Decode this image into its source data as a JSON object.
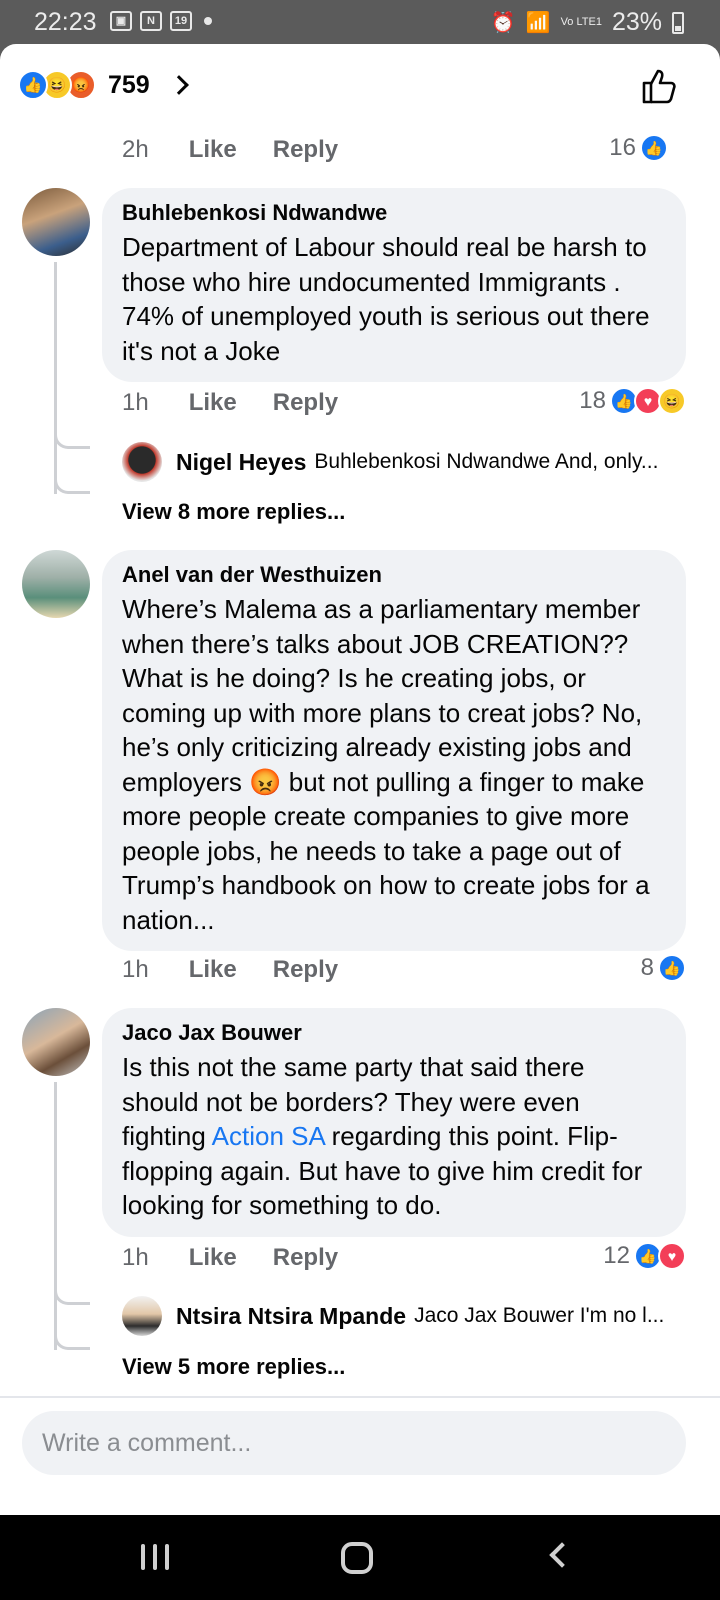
{
  "status_bar": {
    "time": "22:23",
    "notif_icons": [
      "gallery-icon",
      "n-icon",
      "calendar-icon"
    ],
    "calendar_day": "19",
    "n_label": "N",
    "network": "Vo LTE1",
    "battery": "23%"
  },
  "header": {
    "reaction_count": "759",
    "reactions": [
      "like",
      "haha",
      "angry"
    ]
  },
  "top_comment_meta": {
    "time": "2h",
    "like_label": "Like",
    "reply_label": "Reply",
    "reaction_count": "16"
  },
  "comments": [
    {
      "author": "Buhlebenkosi Ndwandwe",
      "text": "Department of Labour should real be harsh to those who hire undocumented Immigrants . 74% of unemployed youth is serious out there it's not a Joke",
      "time": "1h",
      "like_label": "Like",
      "reply_label": "Reply",
      "reaction_count": "18",
      "reply_preview": {
        "author": "Nigel Heyes",
        "snippet": "Buhlebenkosi Ndwandwe And, only..."
      },
      "view_more": "View 8 more replies..."
    },
    {
      "author": "Anel van der Westhuizen",
      "text_part1": "Where’s Malema as a parliamentary member when there’s talks about JOB CREATION?? What is he doing? Is he creating jobs, or coming up with more plans to creat jobs? No, he’s only criticizing already existing jobs and employers ",
      "emoji": "😡",
      "text_part2": " but not pulling a finger to make more people create companies to give more people jobs, he needs to take a page out of Trump’s handbook on how to create jobs for a nation...",
      "time": "1h",
      "like_label": "Like",
      "reply_label": "Reply",
      "reaction_count": "8"
    },
    {
      "author": "Jaco Jax Bouwer",
      "text_part1": "Is this not the same party that said there should not be borders? They were even fighting ",
      "link": "Action SA",
      "text_part2": " regarding this point. Flip-flopping again. But have to give him credit for looking for something to do.",
      "time": "1h",
      "like_label": "Like",
      "reply_label": "Reply",
      "reaction_count": "12",
      "reply_preview": {
        "author": "Ntsira Ntsira Mpande",
        "snippet": "Jaco Jax Bouwer I'm no l..."
      },
      "view_more": "View 5 more replies..."
    }
  ],
  "composer": {
    "placeholder": "Write a comment..."
  },
  "colors": {
    "accent": "#1877f2",
    "bubble": "#f0f2f5",
    "muted_text": "#65676b",
    "love": "#f33e58",
    "haha": "#f7c928",
    "angry": "#e95d2a"
  }
}
